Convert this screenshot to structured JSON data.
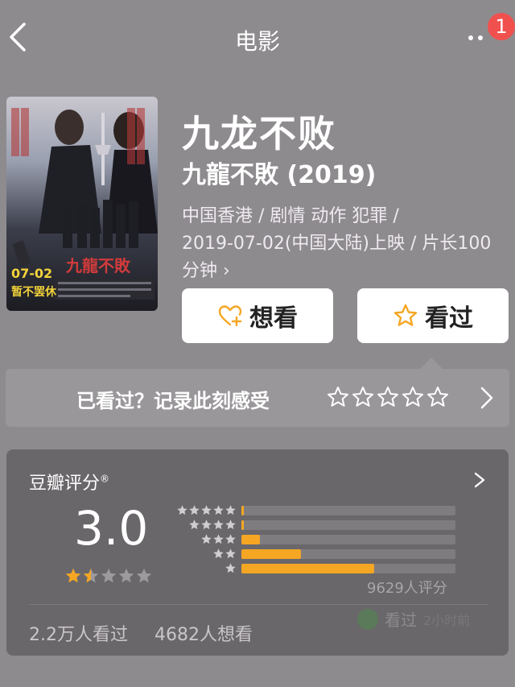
{
  "nav": {
    "title": "电影",
    "badge_count": "1"
  },
  "movie": {
    "title": "九龙不败",
    "original_title": "九龍不敗 (2019)",
    "meta_line1": "中国香港 / 剧情 动作 犯罪 /",
    "meta_line2": "2019-07-02(中国大陆)上映 / 片长100",
    "meta_line3": "分钟 ›"
  },
  "poster": {
    "date_label": "07-02",
    "title_label": "九龍不敗",
    "slogan": "暂不罢休"
  },
  "actions": {
    "want_label": "想看",
    "seen_label": "看过"
  },
  "record": {
    "prompt": "已看过？记录此刻感受"
  },
  "rating": {
    "label": "豆瓣评分",
    "mark": "®",
    "score": "3.0",
    "score_stars": 1.5,
    "distribution": [
      {
        "stars": 5,
        "percent": 0.8
      },
      {
        "stars": 4,
        "percent": 0.8
      },
      {
        "stars": 3,
        "percent": 8.5
      },
      {
        "stars": 2,
        "percent": 27.8
      },
      {
        "stars": 1,
        "percent": 62.1
      }
    ],
    "count": "9629人评分",
    "seen_count": "2.2万人看过",
    "want_count": "4682人想看",
    "activity_text": "看过",
    "activity_time": "2小时前"
  },
  "colors": {
    "accent": "#f5a623",
    "badge": "#f0514f",
    "card": "#6a676a"
  }
}
